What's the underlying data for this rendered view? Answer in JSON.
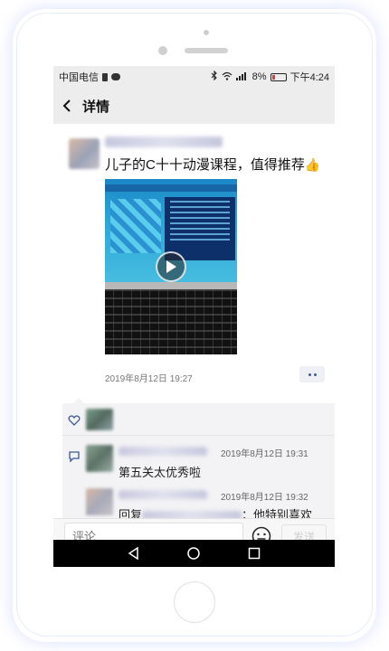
{
  "status_bar": {
    "carrier": "中国电信",
    "battery_percent": "8%",
    "time": "下午4:24"
  },
  "header": {
    "title": "详情",
    "back_icon": "chevron-left-icon"
  },
  "post": {
    "text": "儿子的C十十动漫课程，值得推荐",
    "emoji": "👍",
    "timestamp": "2019年8月12日 19:27",
    "more_icon": "more-dots-icon",
    "play_icon": "play-icon"
  },
  "comments": {
    "like_icon": "heart-icon",
    "comment_icon": "comment-icon",
    "items": [
      {
        "time": "2019年8月12日 19:31",
        "text": "第五关太优秀啦"
      },
      {
        "time": "2019年8月12日 19:32",
        "text_prefix": "回复",
        "text_suffix": "：他特别喜欢"
      }
    ]
  },
  "input": {
    "placeholder": "评论",
    "send_label": "发送",
    "emoji_icon": "smiley-icon"
  },
  "colors": {
    "header_bg": "#ededed",
    "comment_bg": "#f3f3f5",
    "link_blue": "#3b5998",
    "nav_bg": "#000000"
  }
}
